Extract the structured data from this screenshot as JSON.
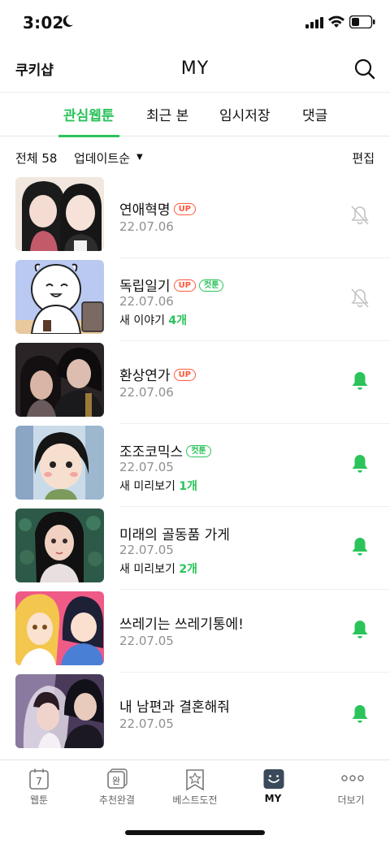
{
  "status_bar": {
    "time": "3:02"
  },
  "header": {
    "left_label": "쿠키샵",
    "title": "MY"
  },
  "tabs": [
    {
      "label": "관심웹툰",
      "active": true
    },
    {
      "label": "최근 본",
      "active": false
    },
    {
      "label": "임시저장",
      "active": false
    },
    {
      "label": "댓글",
      "active": false
    }
  ],
  "toolbar": {
    "count": "전체 58",
    "sort": "업데이트순",
    "sort_caret": "▼",
    "edit": "편집"
  },
  "items": [
    {
      "title": "연애혁명",
      "badges": [
        "UP"
      ],
      "date": "22.07.06",
      "extra_prefix": "",
      "extra_num": "",
      "bell": "bell-off-icon"
    },
    {
      "title": "독립일기",
      "badges": [
        "UP",
        "컷툰"
      ],
      "date": "22.07.06",
      "extra_prefix": "새 이야기 ",
      "extra_num": "4개",
      "bell": "bell-off-icon"
    },
    {
      "title": "환상연가",
      "badges": [
        "UP"
      ],
      "date": "22.07.06",
      "extra_prefix": "",
      "extra_num": "",
      "bell": "bell-icon"
    },
    {
      "title": "조조코믹스",
      "badges": [
        "컷툰"
      ],
      "date": "22.07.05",
      "extra_prefix": "새 미리보기 ",
      "extra_num": "1개",
      "bell": "bell-icon"
    },
    {
      "title": "미래의 골동품 가게",
      "badges": [],
      "date": "22.07.05",
      "extra_prefix": "새 미리보기 ",
      "extra_num": "2개",
      "bell": "bell-icon"
    },
    {
      "title": "쓰레기는 쓰레기통에!",
      "badges": [],
      "date": "22.07.05",
      "extra_prefix": "",
      "extra_num": "",
      "bell": "bell-icon"
    },
    {
      "title": "내 남편과 결혼해줘",
      "badges": [],
      "date": "22.07.05",
      "extra_prefix": "",
      "extra_num": "",
      "bell": "bell-icon"
    }
  ],
  "bottom_nav": [
    {
      "label": "웹툰",
      "icon": "calendar-icon",
      "icon_text": "7"
    },
    {
      "label": "추천완결",
      "icon": "completed-icon",
      "icon_text": "완"
    },
    {
      "label": "베스트도전",
      "icon": "star-icon",
      "icon_text": ""
    },
    {
      "label": "MY",
      "icon": "my-icon",
      "icon_text": "",
      "active": true
    },
    {
      "label": "더보기",
      "icon": "more-icon",
      "icon_text": ""
    }
  ],
  "colors": {
    "accent": "#2bc35a",
    "up_badge": "#ff5a3c",
    "text": "#111111",
    "muted": "#8f8f8f"
  }
}
